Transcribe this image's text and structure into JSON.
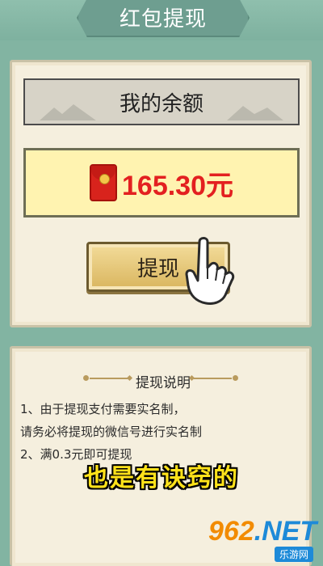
{
  "header": {
    "title": "红包提现"
  },
  "balance": {
    "header_label": "我的余额",
    "amount": "165.30元",
    "icon": "red-envelope-icon"
  },
  "withdraw": {
    "button_label": "提现",
    "hint_icon": "pointing-hand-icon"
  },
  "instructions": {
    "title": "提现说明",
    "lines": [
      "1、由于提现支付需要实名制，",
      "请务必将提现的微信号进行实名制",
      "2、满0.3元即可提现"
    ]
  },
  "caption": "也是有诀窍的",
  "watermark": {
    "brand_digits": "962",
    "brand_suffix": ".NET",
    "subtitle": "乐游网"
  },
  "colors": {
    "background": "#82b4a2",
    "panel": "#f5efde",
    "amount": "#e32020",
    "caption": "#ffe21a"
  }
}
